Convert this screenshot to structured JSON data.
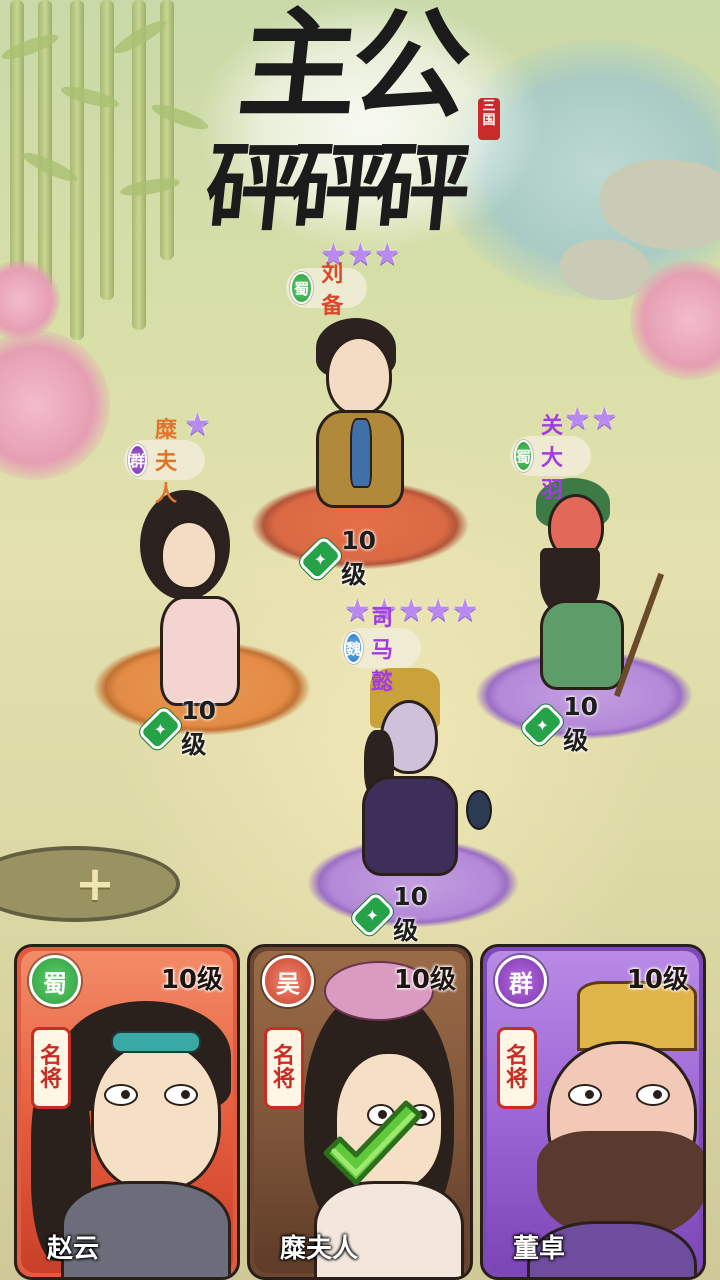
{
  "title": {
    "line1": "主公",
    "line2": "砰砰砰",
    "seal": "三国"
  },
  "colors": {
    "shu": "#2f9e3f",
    "qun": "#7d37b0",
    "wei": "#2f7fc4",
    "wu": "#c7412b",
    "level_gem": "#26a349"
  },
  "heroes": [
    {
      "name": "刘备",
      "faction": "蜀",
      "stars": 3,
      "stars_text": "★★★",
      "level": "10级"
    },
    {
      "name": "糜夫人",
      "faction": "群",
      "stars": 1,
      "stars_text": "★",
      "level": "10级"
    },
    {
      "name": "关大羽",
      "faction": "蜀",
      "stars": 2,
      "stars_text": "★★",
      "level": "10级"
    },
    {
      "name": "司马懿",
      "faction": "魏",
      "stars": 5,
      "stars_text": "★★★★★",
      "level": "10级"
    }
  ],
  "add_slot": {
    "icon": "plus-icon",
    "label": "+"
  },
  "cards": [
    {
      "name": "赵云",
      "faction": "蜀",
      "level": "10级",
      "rank_line1": "名",
      "rank_line2": "将",
      "selected": false
    },
    {
      "name": "糜夫人",
      "faction": "吴",
      "level": "10级",
      "rank_line1": "名",
      "rank_line2": "将",
      "selected": true
    },
    {
      "name": "董卓",
      "faction": "群",
      "level": "10级",
      "rank_line1": "名",
      "rank_line2": "将",
      "selected": false
    }
  ]
}
